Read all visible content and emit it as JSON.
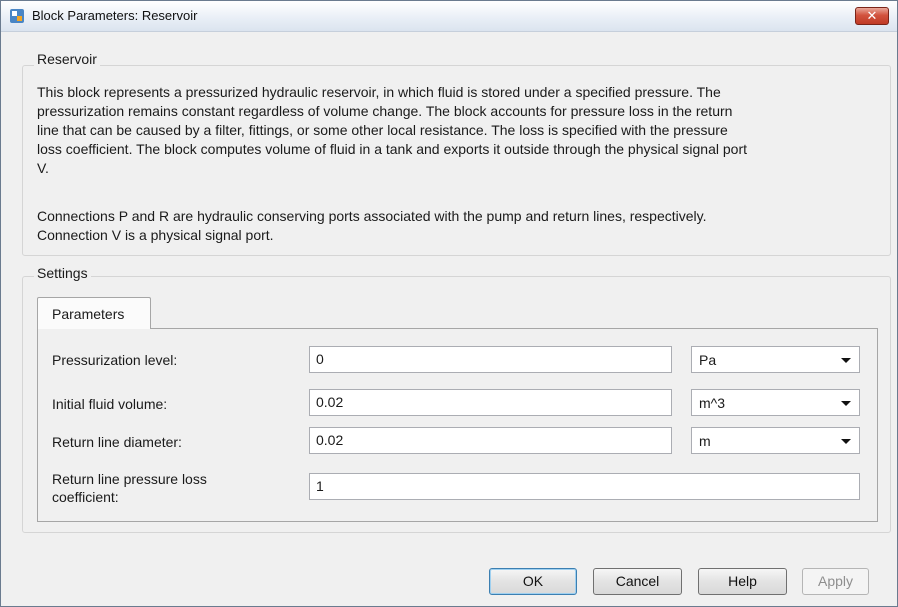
{
  "window": {
    "title": "Block Parameters: Reservoir",
    "close_label": "✕"
  },
  "description": {
    "group_label": "Reservoir",
    "lines": [
      "This block represents a pressurized hydraulic reservoir, in which fluid is stored under a specified pressure. The",
      "pressurization remains constant regardless of volume change. The block accounts for pressure loss in the return",
      "line that can be caused by a filter, fittings, or some other local resistance. The loss is specified with the pressure",
      "loss coefficient. The block computes volume of fluid in a tank and exports it outside through the physical signal port",
      "V.",
      "Connections P and R are hydraulic conserving ports associated with the pump and return lines, respectively.",
      "Connection V is a physical signal port."
    ]
  },
  "settings": {
    "group_label": "Settings",
    "tab_label": "Parameters",
    "params": [
      {
        "label": "Pressurization level:",
        "value": "0",
        "unit": "Pa"
      },
      {
        "label": "Initial fluid volume:",
        "value": "0.02",
        "unit": "m^3"
      },
      {
        "label": "Return line diameter:",
        "value": "0.02",
        "unit": "m"
      },
      {
        "label_line1": "Return line pressure loss",
        "label_line2": "coefficient:",
        "value": "1"
      }
    ]
  },
  "buttons": {
    "ok": "OK",
    "cancel": "Cancel",
    "help": "Help",
    "apply": "Apply"
  },
  "colors": {
    "close_button": "#c9432d",
    "default_button_border": "#3c7fb1",
    "disabled_text": "#8e8e8e"
  }
}
